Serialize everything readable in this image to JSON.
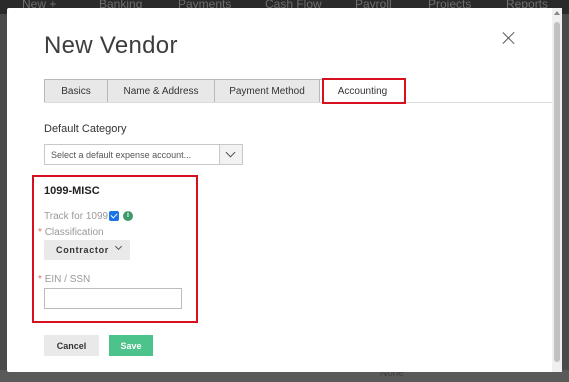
{
  "background": {
    "nav_items": [
      "New +",
      "Banking",
      "Payments",
      "Cash Flow",
      "Payroll",
      "Projects",
      "Reports"
    ],
    "footer_text": "None"
  },
  "modal": {
    "title": "New Vendor",
    "close_icon": "close-icon",
    "tabs": [
      {
        "label": "Basics"
      },
      {
        "label": "Name & Address"
      },
      {
        "label": "Payment Method"
      },
      {
        "label": "Accounting",
        "active": true
      }
    ],
    "default_category": {
      "label": "Default Category",
      "placeholder": "Select a default expense account..."
    },
    "misc1099": {
      "title": "1099-MISC",
      "track_label": "Track for 1099",
      "track_checked": true,
      "info_icon": "info-icon",
      "classification_label": "Classification",
      "classification_value": "Contractor",
      "ein_label": "EIN / SSN",
      "ein_value": "",
      "required_marker": "*"
    },
    "buttons": {
      "cancel": "Cancel",
      "save": "Save"
    }
  },
  "colors": {
    "highlight": "#d6101e",
    "save_green": "#4cc38a",
    "checkbox_blue": "#1a73e8",
    "info_green": "#3c9a6c"
  }
}
